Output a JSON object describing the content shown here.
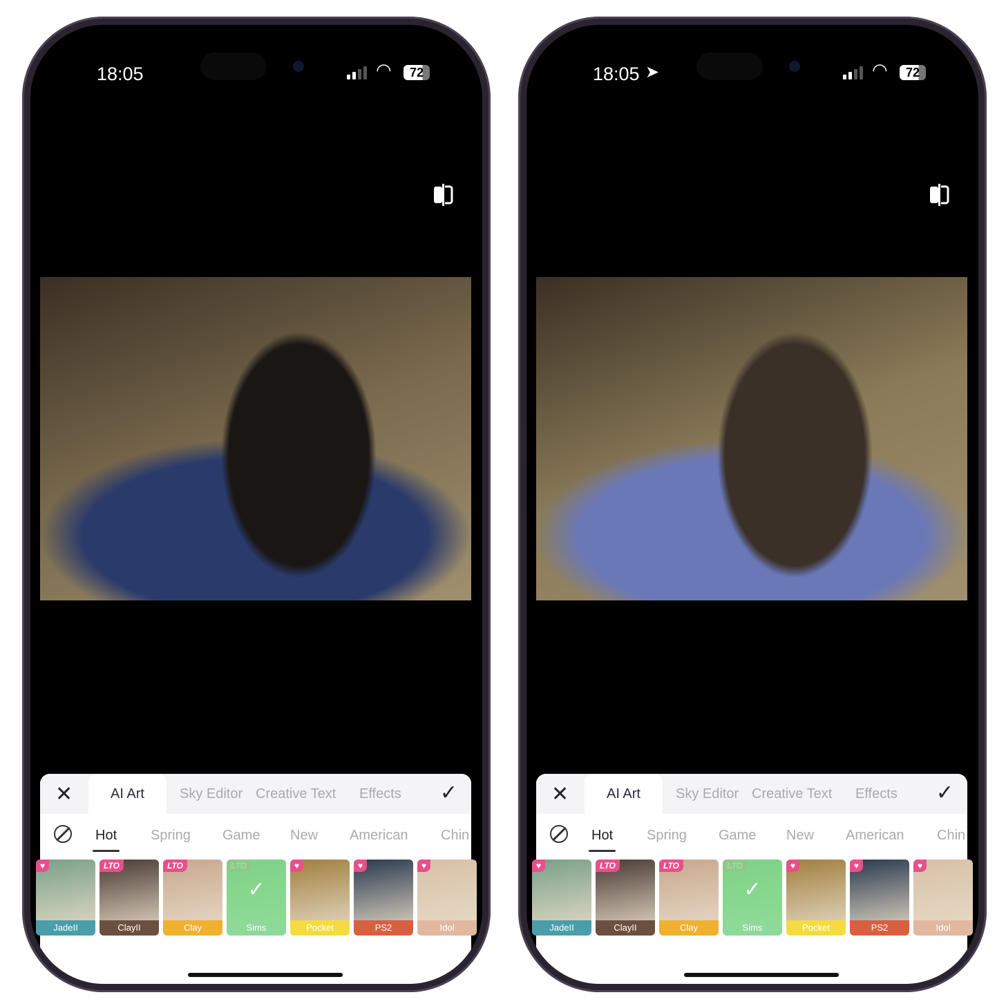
{
  "phones": [
    {
      "status": {
        "time": "18:05",
        "battery": "72",
        "location_arrow": false
      },
      "photo_colors": [
        "#7a6a4e",
        "#2a3a6a",
        "#1a1614"
      ]
    },
    {
      "status": {
        "time": "18:05",
        "battery": "72",
        "location_arrow": true
      },
      "photo_colors": [
        "#8a7a58",
        "#6a78b8",
        "#3a3028"
      ]
    }
  ],
  "toolbar": {
    "close_icon": "close-icon",
    "confirm_icon": "checkmark-icon",
    "tabs": [
      "AI Art",
      "Sky Editor",
      "Creative Text",
      "Effects"
    ],
    "active_tab": "AI Art"
  },
  "categories": {
    "items": [
      "Hot",
      "Spring",
      "Game",
      "New",
      "American",
      "Chin"
    ],
    "active": "Hot"
  },
  "styles": [
    {
      "label": "JadeII",
      "color": "#4a9eaa",
      "badge": "heart",
      "bg": "#7aa08a"
    },
    {
      "label": "ClayII",
      "color": "#6b5040",
      "badge": "LTO",
      "bg": "#4a3a34"
    },
    {
      "label": "Clay",
      "color": "#f0b030",
      "badge": "LTO",
      "bg": "#c8a890"
    },
    {
      "label": "Sims",
      "color": "#8ed89a",
      "badge": "LTO",
      "bg": "#6a9a70",
      "selected": true
    },
    {
      "label": "Pocket",
      "color": "#f4dc40",
      "badge": "heart",
      "bg": "#a08040"
    },
    {
      "label": "PS2",
      "color": "#d86040",
      "badge": "heart",
      "bg": "#2a3a50"
    },
    {
      "label": "Idol",
      "color": "#e0b8a0",
      "badge": "heart",
      "bg": "#d8c0a8"
    }
  ]
}
